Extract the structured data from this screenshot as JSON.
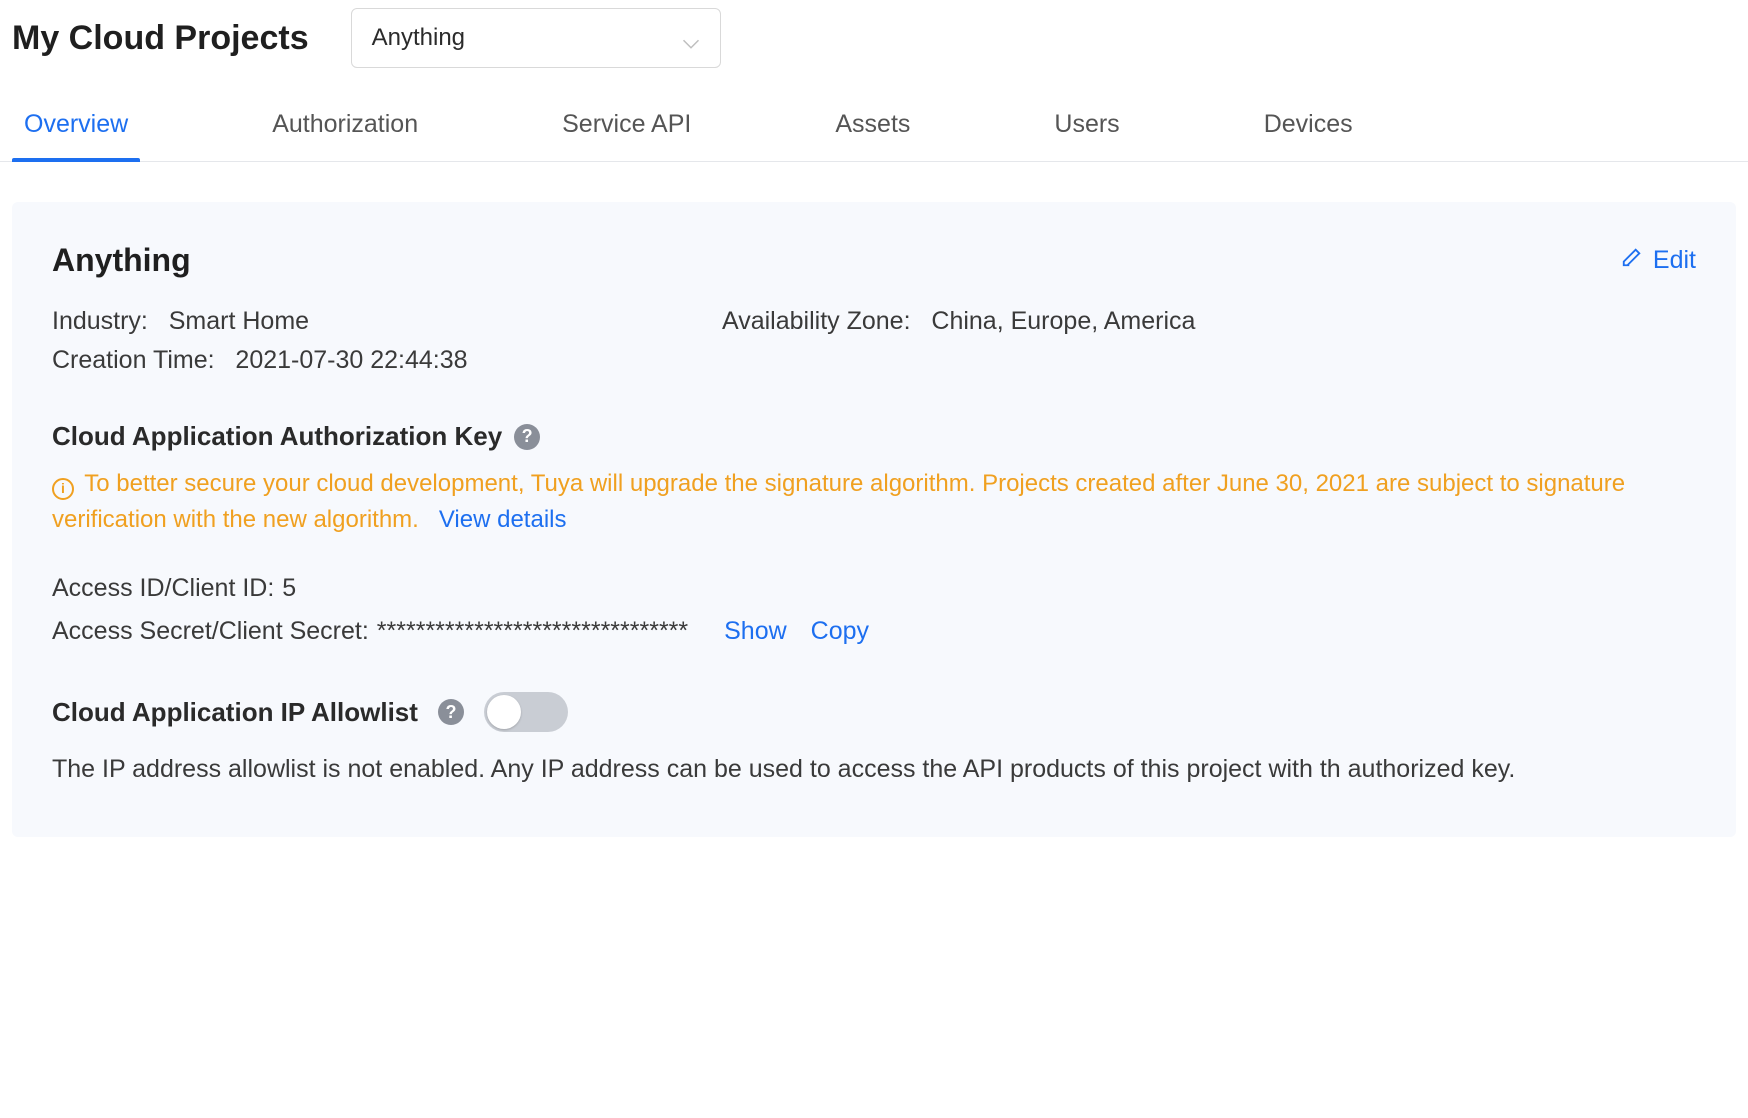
{
  "header": {
    "title": "My Cloud Projects",
    "selected_project": "Anything"
  },
  "tabs": [
    {
      "label": "Overview",
      "active": true
    },
    {
      "label": "Authorization",
      "active": false
    },
    {
      "label": "Service API",
      "active": false
    },
    {
      "label": "Assets",
      "active": false
    },
    {
      "label": "Users",
      "active": false
    },
    {
      "label": "Devices",
      "active": false
    }
  ],
  "overview": {
    "project_name": "Anything",
    "edit_label": "Edit",
    "industry_label": "Industry:",
    "industry_value": "Smart Home",
    "availability_label": "Availability Zone:",
    "availability_value": "China, Europe, America",
    "creation_label": "Creation Time:",
    "creation_value": "2021-07-30 22:44:38",
    "auth_key_title": "Cloud Application Authorization Key",
    "notice_text": "To better secure your cloud development, Tuya will upgrade the signature algorithm. Projects created after June 30, 2021 are subject to signature verification with the new algorithm.",
    "notice_link": "View details",
    "access_id_label": "Access ID/Client ID:",
    "access_id_value": "5",
    "access_secret_label": "Access Secret/Client Secret:",
    "access_secret_value": "********************************",
    "show_label": "Show",
    "copy_label": "Copy",
    "allowlist_title": "Cloud Application IP Allowlist",
    "allowlist_desc": "The IP address allowlist is not enabled. Any IP address can be used to access the API products of this project with th authorized key."
  }
}
